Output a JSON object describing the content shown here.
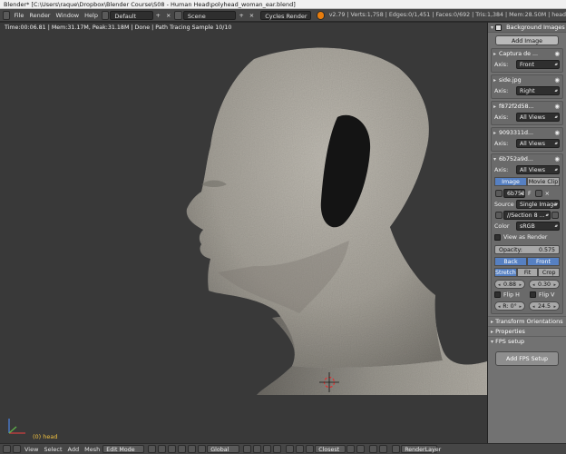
{
  "window": {
    "title": "Blender* [C:\\Users\\raque\\Dropbox\\Blender Course\\S08 - Human Head\\polyhead_woman_ear.blend]"
  },
  "info_header": {
    "menus": [
      "File",
      "Render",
      "Window",
      "Help"
    ],
    "layout": "Default",
    "scene": "Scene",
    "engine": "Cycles Render",
    "stats": "v2.79 | Verts:1,758 | Edges:0/1,451 | Faces:0/692 | Tris:1,384 | Mem:28.50M | head"
  },
  "viewport": {
    "render_info": "Time:00:06.81 | Mem:31.17M, Peak:31.18M | Done | Path Tracing Sample 10/10",
    "object_label": "(0) head"
  },
  "panel": {
    "section_title": "Background Images",
    "add_image": "Add Image",
    "images": [
      {
        "name": "Captura de ...",
        "axis_label": "Axis:",
        "axis": "Front"
      },
      {
        "name": "side.jpg",
        "axis_label": "Axis:",
        "axis": "Right"
      },
      {
        "name": "f872f2d58...",
        "axis_label": "Axis:",
        "axis": "All Views"
      },
      {
        "name": "9093311d...",
        "axis_label": "Axis:",
        "axis": "All Views"
      },
      {
        "name": "6b752a9d...",
        "axis_label": "Axis:",
        "axis": "All Views"
      }
    ],
    "source_tabs": [
      "Image",
      "Movie Clip"
    ],
    "image_field": "6b752",
    "image_field_flag": "F",
    "source_label": "Source",
    "source_value": "Single Image",
    "filepath": "//Section 8 ...",
    "color_label": "Color",
    "color_value": "sRGB",
    "view_as_render": "View as Render",
    "opacity_label": "Opacity:",
    "opacity_value": "0.575",
    "depth_tabs": [
      "Back",
      "Front"
    ],
    "frame_tabs": [
      "Stretch",
      "Fit",
      "Crop"
    ],
    "offset_x": "0.88",
    "offset_y": "0.30",
    "flip_h": "Flip H",
    "flip_v": "Flip V",
    "rotation": "R: 0°",
    "size": "24.5",
    "sections": [
      "Transform Orientations",
      "Properties"
    ],
    "fps_section": "FPS setup",
    "add_fps": "Add FPS Setup"
  },
  "bottom_bar": {
    "menus": [
      "View",
      "Select",
      "Add",
      "Mesh"
    ],
    "mode": "Edit Mode",
    "orientation": "Global",
    "snap": "Closest",
    "render_layer": "RenderLayer"
  },
  "colors": {
    "viewport_bg": "#393939",
    "skin": "#b8b4ab",
    "ear_patch": "#141414",
    "panel_bg": "#727272",
    "selected_blue": "#5680c2",
    "object_label": "#f0c040"
  }
}
